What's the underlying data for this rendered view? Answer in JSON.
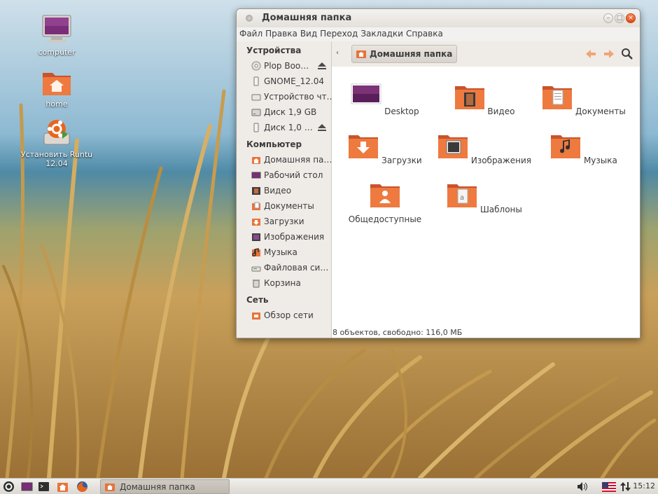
{
  "desktop": {
    "icons": [
      {
        "label": "computer",
        "icon": "monitor-icon"
      },
      {
        "label": "home",
        "icon": "home-folder-icon"
      },
      {
        "label": "Установить Runtu 12.04",
        "icon": "installer-icon"
      }
    ]
  },
  "window": {
    "title": "Домашняя папка",
    "controls": {
      "minimize": "–",
      "maximize": "□",
      "close": "×"
    }
  },
  "menubar": [
    "Файл",
    "Правка",
    "Вид",
    "Переход",
    "Закладки",
    "Справка"
  ],
  "sidebar": {
    "devices_header": "Устройства",
    "devices": [
      "Plop Boo…",
      "GNOME_12.04",
      "Устройство чт…",
      "Диск 1,9 GB",
      "Диск 1,0 …"
    ],
    "computer_header": "Компьютер",
    "computer": [
      "Домашняя па…",
      "Рабочий стол",
      "Видео",
      "Документы",
      "Загрузки",
      "Изображения",
      "Музыка",
      "Файловая си…",
      "Корзина"
    ],
    "network_header": "Сеть",
    "network": [
      "Обзор сети"
    ]
  },
  "toolbar": {
    "breadcrumb_left": "‹",
    "location": "Домашняя папка"
  },
  "files": [
    "Desktop",
    "Видео",
    "Документы",
    "Загрузки",
    "Изображения",
    "Музыка",
    "Общедоступные",
    "Шаблоны"
  ],
  "status": "8 объектов, свободно: 116,0 МБ",
  "panel": {
    "task_title": "Домашняя папка",
    "clock": "15:12"
  },
  "colors": {
    "accent": "#e0622a",
    "folder": "#e8743b",
    "panel": "#e7e4df"
  }
}
